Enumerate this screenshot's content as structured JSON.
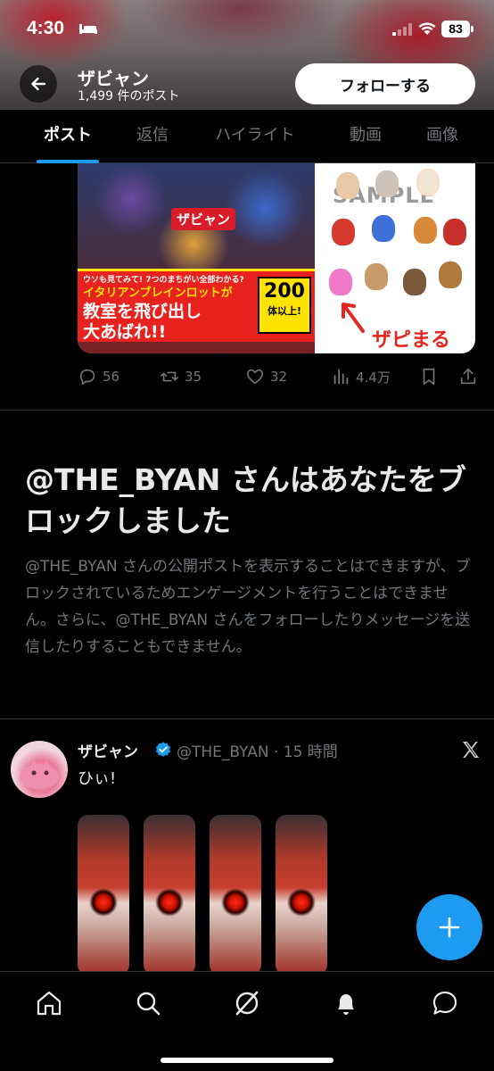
{
  "status_bar": {
    "time": "4:30",
    "battery": "83"
  },
  "profile": {
    "name": "ザビャン",
    "post_count": "1,499 件のポスト",
    "follow_label": "フォローする"
  },
  "tabs": [
    {
      "label": "ポスト",
      "active": true
    },
    {
      "label": "返信",
      "active": false
    },
    {
      "label": "ハイライト",
      "active": false
    },
    {
      "label": "動画",
      "active": false
    },
    {
      "label": "画像",
      "active": false
    }
  ],
  "media_card": {
    "brand": "ザビャン",
    "promo_small": "ウソも見てみて! 7つのまちがい全部わかる?",
    "promo_line1": "イタリアンブレインロットが",
    "promo_line2": "教室を飛び出し",
    "promo_line3": "大あばれ!!",
    "promo_badge_num": "200",
    "promo_badge_sub": "体以上!",
    "sample_text": "SAMPLE",
    "zapi_label": "ザピまる"
  },
  "post_actions": {
    "replies": "56",
    "reposts": "35",
    "likes": "32",
    "views": "4.4万"
  },
  "blocked_notice": {
    "title": "@THE_BYAN さんはあなたをブロックしました",
    "body": "@THE_BYAN さんの公開ポストを表示することはできますが、ブロックされているためエンゲージメントを行うことはできません。さらに、@THE_BYAN さんをフォローしたりメッセージを送信したりすることもできません。"
  },
  "second_post": {
    "author": "ザビャン",
    "handle_time": "@THE_BYAN · 15 時間",
    "text": "ひぃ!"
  },
  "colors": {
    "accent": "#1d9bf0",
    "background": "#000000",
    "muted": "#71767b",
    "text": "#e7e9ea"
  },
  "icons": {
    "back": "arrow-left-icon",
    "verified": "verified-badge-icon",
    "compose": "plus-icon",
    "nav": [
      "home-icon",
      "search-icon",
      "grok-icon",
      "notifications-icon",
      "messages-icon"
    ]
  }
}
